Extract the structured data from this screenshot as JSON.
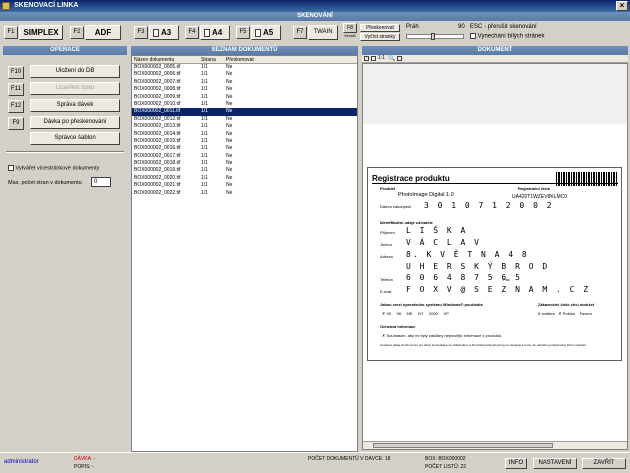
{
  "window": {
    "title": "SKENOVACÍ LINKA",
    "close_glyph": "×"
  },
  "toolbar": {
    "section_title": "SKENOVÁNÍ",
    "f1": "F1",
    "simplex": "SIMPLEX",
    "f2": "F2",
    "adf": "ADF",
    "f3": "F3",
    "a3": "A3",
    "f4": "F4",
    "a4": "A4",
    "f5": "F5",
    "a5": "A5",
    "f7": "F7",
    "twain": "TWAIN",
    "f8": "F8",
    "f8_sub": "Kreslit",
    "prohledavat": "Přeskenovat",
    "vybrat": "Vyčíst stranky",
    "prah_label": "Práh",
    "prah_value": "90",
    "esc_label": "ESC - přerušit skenování",
    "vynechani_label": "Vynechání bílých stránek"
  },
  "operace": {
    "title": "OPERACE",
    "buttons": [
      {
        "key": "F10",
        "label": "Uložení do DB",
        "disabled": false
      },
      {
        "key": "F11",
        "label": "Uzavření boxu",
        "disabled": true
      },
      {
        "key": "F12",
        "label": "Správa dávek",
        "disabled": false
      },
      {
        "key": "F9",
        "label": "Dávka po přeskenování",
        "disabled": false
      },
      {
        "key": "",
        "label": "Správce šablon",
        "disabled": false
      }
    ],
    "vicestrankove": "Vytvářet vícestránkové dokumenty",
    "max_pocet_label": "Max. počet stran v dokumentu",
    "max_pocet_value": "0"
  },
  "seznam": {
    "title": "SEZNAM DOKUMENTŮ",
    "columns": [
      "Název dokumentu",
      "Strana",
      "Přeskenovat"
    ],
    "rows": [
      [
        "BOX000002_0005.tif",
        "1/1",
        "Ne"
      ],
      [
        "BOX000002_0006.tif",
        "1/1",
        "Ne"
      ],
      [
        "BOX000002_0007.tif",
        "1/1",
        "Ne"
      ],
      [
        "BOX000002_0008.tif",
        "1/1",
        "Ne"
      ],
      [
        "BOX000002_0009.tif",
        "1/1",
        "Ne"
      ],
      [
        "BOX000002_0010.tif",
        "1/1",
        "Ne"
      ],
      [
        "BOX000002_0011.tif",
        "1/1",
        "Ne"
      ],
      [
        "BOX000002_0012.tif",
        "1/1",
        "Ne"
      ],
      [
        "BOX000002_0013.tif",
        "1/1",
        "Ne"
      ],
      [
        "BOX000002_0014.tif",
        "1/1",
        "Ne"
      ],
      [
        "BOX000002_0015.tif",
        "1/1",
        "Ne"
      ],
      [
        "BOX000002_0016.tif",
        "1/1",
        "Ne"
      ],
      [
        "BOX000002_0017.tif",
        "1/1",
        "Ne"
      ],
      [
        "BOX000002_0018.tif",
        "1/1",
        "Ne"
      ],
      [
        "BOX000002_0019.tif",
        "1/1",
        "Ne"
      ],
      [
        "BOX000002_0020.tif",
        "1/1",
        "Ne"
      ],
      [
        "BOX000002_0021.tif",
        "1/1",
        "Ne"
      ],
      [
        "BOX000002_0022.tif",
        "1/1",
        "Ne"
      ]
    ],
    "selected_index": 6
  },
  "dokument": {
    "title": "DOKUMENT",
    "zoom": "1:1",
    "form": {
      "heading": "Registrace produktu",
      "produkt_label": "Produkt",
      "produkt_value": "PhotoImage Digital 1.0",
      "reg_cislo_label": "Registrační číslo",
      "reg_cislo_value": "UA420T1WZEV8KLMC0",
      "datum_label": "Datum zakoupení",
      "datum_value": "3 0 1 0 7 1 2 0 0 2",
      "ident_label": "Identifikační údaje uživatele",
      "prijmeni_label": "Příjmení",
      "prijmeni_value": "L I Š K A",
      "jmeno_label": "Jméno",
      "jmeno_value": "V Á C L A V",
      "adresa_label": "Adresa",
      "adresa_value": "8. K V Ě T N A  4 8",
      "adresa_value2": "U H E R S K Ý  B R O D",
      "telefon_label": "Telefon",
      "telefon_value": "6 0 6 4 8 7 5 6 5",
      "fax_label": "Fax",
      "email_label": "E-mail",
      "email_value": "F O X V @ S E Z N A M . C Z",
      "os_label": "Jakou verzi operačního systému Windows® používáte",
      "os_options": [
        "95",
        "98",
        "ME",
        "NT",
        "2000",
        "XP"
      ],
      "zakaznik_label": "Zákaznické číslo chci obdržet",
      "zakaznik_options": [
        "E-mailem",
        "Poštou",
        "Faxem"
      ],
      "ochrana_label": "Ochrana informací",
      "souhlas": "Souhlasím, aby mi byly zasílány nejnovější informace o produktu.",
      "fine_print": "Uvedené údaje slouží pouze pro účely komunikace se zákazníkem a firma Easyd Engineering se zavazuje k tomu, že nebudou poskytovány třetím stranám."
    }
  },
  "status": {
    "user": "administrator",
    "davka_label": "DÁVKA: -",
    "popis_label": "POPIS: -",
    "pocet_davka": "POČET DOKUMENTŮ V DÁVCE: 18",
    "box": "BOX: BOX000002",
    "pocet_listu": "POČET LISTŮ: 22",
    "info": "INFO",
    "nastaveni": "NASTAVENÍ",
    "zavrit": "ZAVŘÍT"
  },
  "colors": {
    "accent": "#0a246a",
    "section": "#6e8fb8",
    "user": "#0000c0",
    "davka": "#c00000"
  }
}
